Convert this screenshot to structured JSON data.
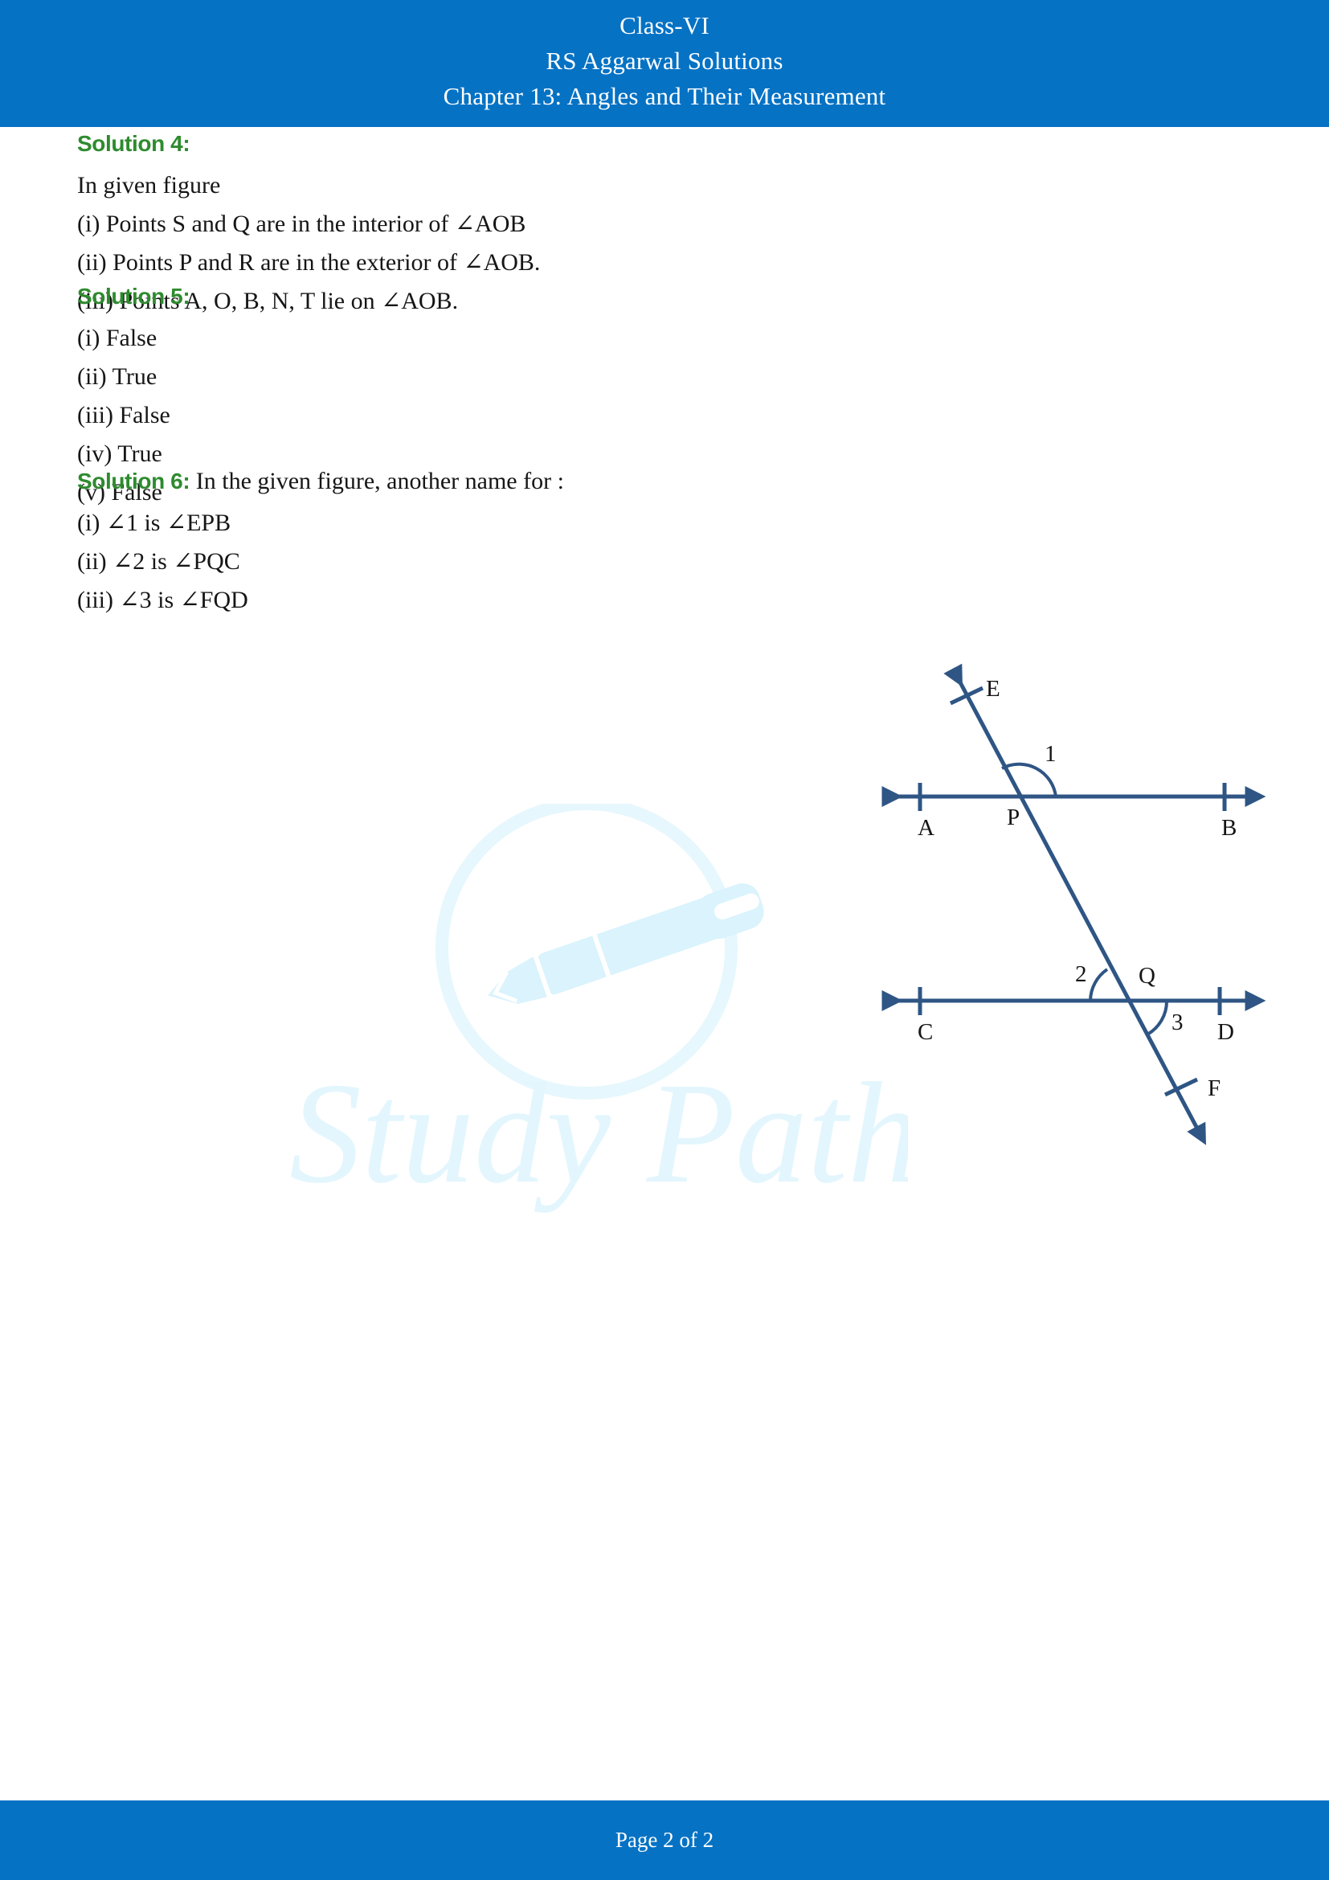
{
  "header": {
    "line1": "Class-VI",
    "line2": "RS Aggarwal Solutions",
    "line3": "Chapter 13: Angles and Their Measurement"
  },
  "footer": {
    "page_text": "Page 2 of 2"
  },
  "colors": {
    "banner_blue": "#0572c4",
    "heading_green": "#2e8b2e",
    "body_text": "#161616",
    "figure_stroke": "#2e5584",
    "watermark": "#e3f6fd"
  },
  "solutions": [
    {
      "heading": "Solution 4:",
      "intro": "In given figure",
      "lines": [
        "(i) Points S and Q are in the interior of ∠AOB",
        "(ii) Points P and R are in the exterior of ∠AOB.",
        "(iii) Points A, O, B, N, T lie on ∠AOB."
      ]
    },
    {
      "heading": "Solution 5:",
      "lines": [
        "(i) False",
        "(ii) True",
        "(iii) False",
        "(iv) True",
        "(v) False"
      ]
    },
    {
      "heading": "Solution 6:",
      "heading_suffix": " In the given figure, another name for :",
      "lines": [
        "(i) ∠1 is ∠EPB",
        "(ii) ∠2 is ∠PQC",
        "(iii) ∠3 is ∠FQD"
      ]
    }
  ],
  "figure": {
    "name": "two-parallel-lines-with-transversal",
    "labels": {
      "A": "A",
      "B": "B",
      "C": "C",
      "D": "D",
      "E": "E",
      "F": "F",
      "P": "P",
      "Q": "Q",
      "angle1": "1",
      "angle2": "2",
      "angle3": "3"
    }
  },
  "watermark": {
    "text": "Study Path",
    "icon": "fountain-pen-icon"
  }
}
